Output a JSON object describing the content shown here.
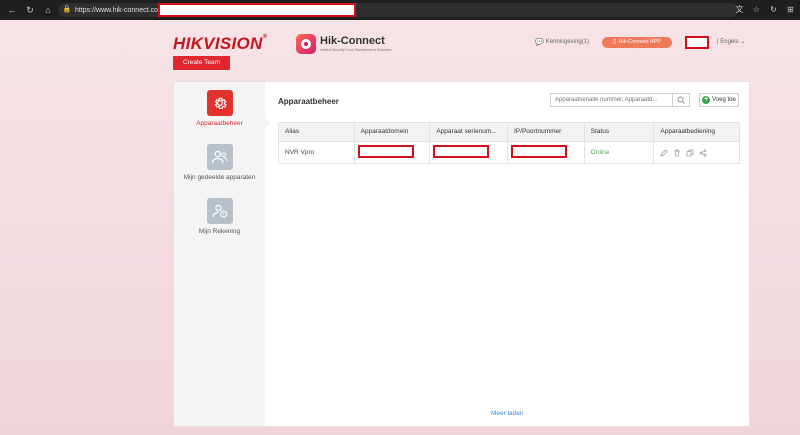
{
  "browser": {
    "url": "https://www.hik-connect.com/"
  },
  "header": {
    "brand": "HIKVISION",
    "create_team_label": "Create Team",
    "app_name": "Hik-Connect",
    "app_tagline": "Unified Security From Standalone to Business",
    "notification_label": "Kennisgeving(1)",
    "app_button_label": "Hik-Connect APP",
    "language_label": "| Engels"
  },
  "sidebar": {
    "items": [
      {
        "label": "Apparaatbeheer",
        "icon": "gear-icon",
        "active": true
      },
      {
        "label": "Mijn gedeelde apparaten",
        "icon": "shared-users-icon",
        "active": false
      },
      {
        "label": "Mijn Rekening",
        "icon": "account-icon",
        "active": false
      }
    ]
  },
  "content": {
    "title": "Apparaatbeheer",
    "search_placeholder": "Apparaatserialle nummer, Apparaatd...",
    "add_label": "Voeg toe",
    "columns": [
      "Alias",
      "Apparaatdomein",
      "Apparaat serienum...",
      "IP/Poortnummer",
      "Status",
      "Apparaatbediening"
    ],
    "rows": [
      {
        "alias": "NVR Vpro",
        "domain": "",
        "serial": "",
        "ip": "",
        "status": "Online"
      }
    ],
    "load_more_label": "Meer laden"
  },
  "colors": {
    "brand_red": "#c8151d",
    "status_online": "#4caf50",
    "link_blue": "#3b8ad9"
  }
}
